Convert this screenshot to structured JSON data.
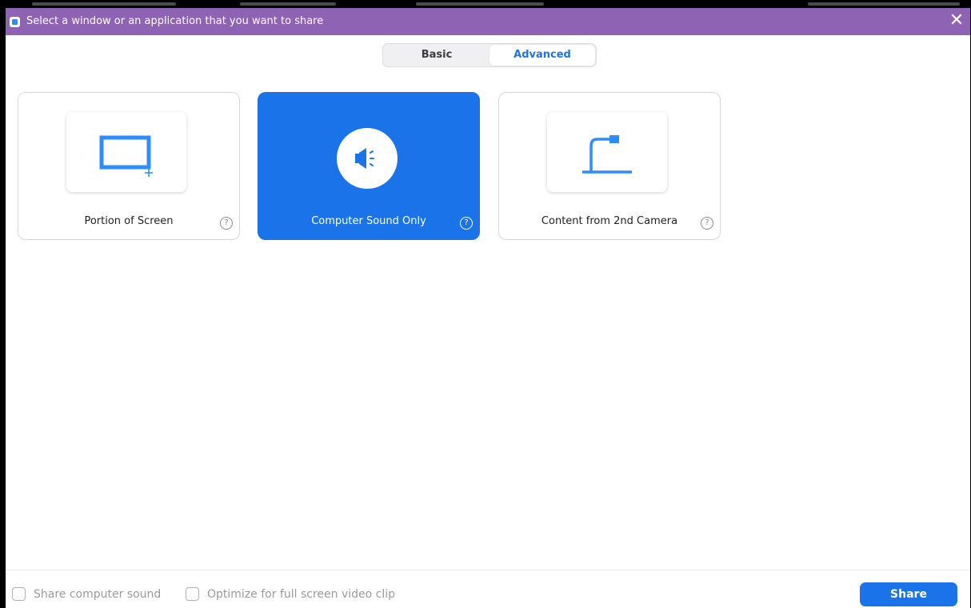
{
  "window": {
    "title": "Select a window or an application that you want to share",
    "close_glyph": "✕"
  },
  "tabs": [
    {
      "label": "Basic",
      "selected": false
    },
    {
      "label": "Advanced",
      "selected": true
    }
  ],
  "cards": [
    {
      "label": "Portion of Screen",
      "icon": "screen-portion-icon",
      "selected": false
    },
    {
      "label": "Computer Sound Only",
      "icon": "speaker-icon",
      "selected": true
    },
    {
      "label": "Content from 2nd Camera",
      "icon": "document-camera-icon",
      "selected": false
    }
  ],
  "help_glyph": "?",
  "footer": {
    "share_sound_label": "Share computer sound",
    "share_sound_checked": false,
    "optimize_label": "Optimize for full screen video clip",
    "optimize_checked": false,
    "share_button": "Share"
  },
  "colors": {
    "titlebar": "#8e63b3",
    "accent": "#1a73e8",
    "icon_blue": "#2d8cff"
  }
}
